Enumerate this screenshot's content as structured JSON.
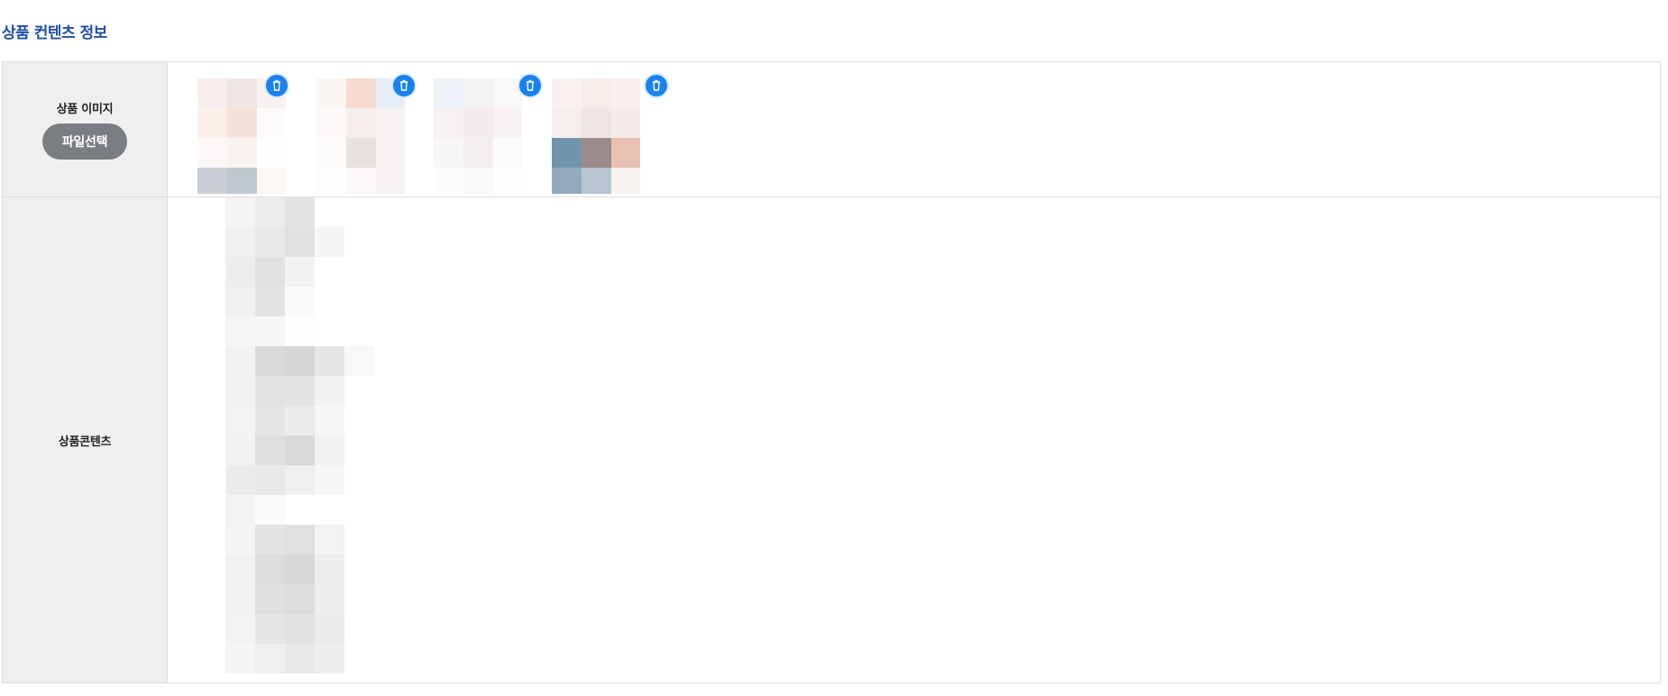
{
  "section": {
    "title": "상품 컨텐츠 정보"
  },
  "form": {
    "image_row": {
      "label": "상품 이미지",
      "file_button_label": "파일선택",
      "thumbnails": [
        {
          "name": "product-image-1"
        },
        {
          "name": "product-image-2"
        },
        {
          "name": "product-image-3"
        },
        {
          "name": "product-image-4"
        }
      ],
      "delete_icon": "trash-icon"
    },
    "content_row": {
      "label": "상품콘텐츠"
    }
  },
  "colors": {
    "title": "#1f4fa8",
    "label_bg": "#efefef",
    "border": "#dcdcdc",
    "file_button": "#7a7d82",
    "delete_badge": "#1a82f0"
  }
}
